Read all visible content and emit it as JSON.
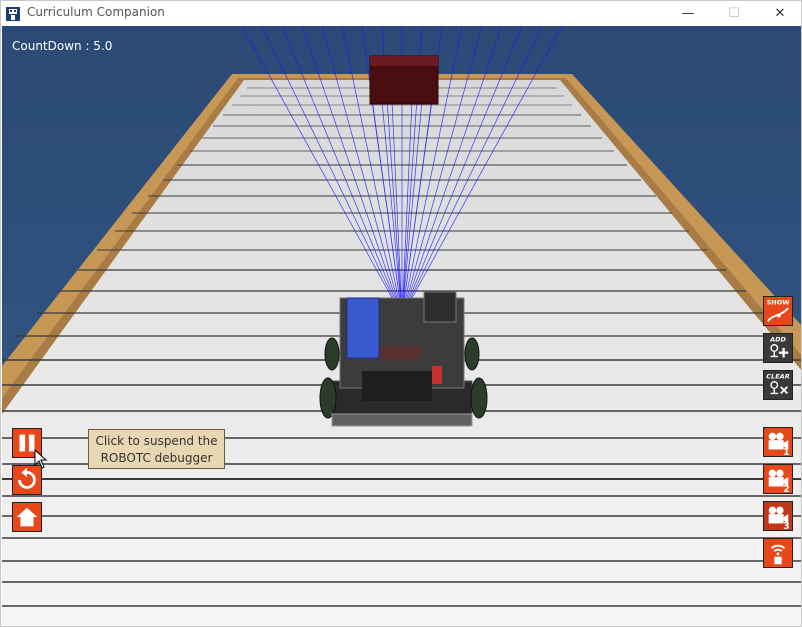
{
  "window": {
    "title": "Curriculum Companion",
    "controls": {
      "minimize": "—",
      "maximize": "☐",
      "close": "✕"
    }
  },
  "hud": {
    "countdown_text": "CountDown : 5.0"
  },
  "left_controls": {
    "pause": {
      "icon": "pause-icon"
    },
    "reset": {
      "icon": "reset-icon"
    },
    "home": {
      "icon": "home-icon"
    },
    "tooltip_text": "Click to suspend the ROBOTC debugger"
  },
  "right_controls": {
    "show_label": "SHOW",
    "add_label": "ADD",
    "clear_label": "CLEAR",
    "camera1_label": "1",
    "camera2_label": "2",
    "camera3_label": "3",
    "remote_icon": "remote-signal-icon"
  },
  "colors": {
    "accent_orange": "#e8471a",
    "dark_button": "#3a3a3a",
    "sky": "#2f4f7a",
    "table_wood": "#c89a56",
    "mat": "#f2f2f2",
    "sensor_beam": "#1a1aff"
  }
}
